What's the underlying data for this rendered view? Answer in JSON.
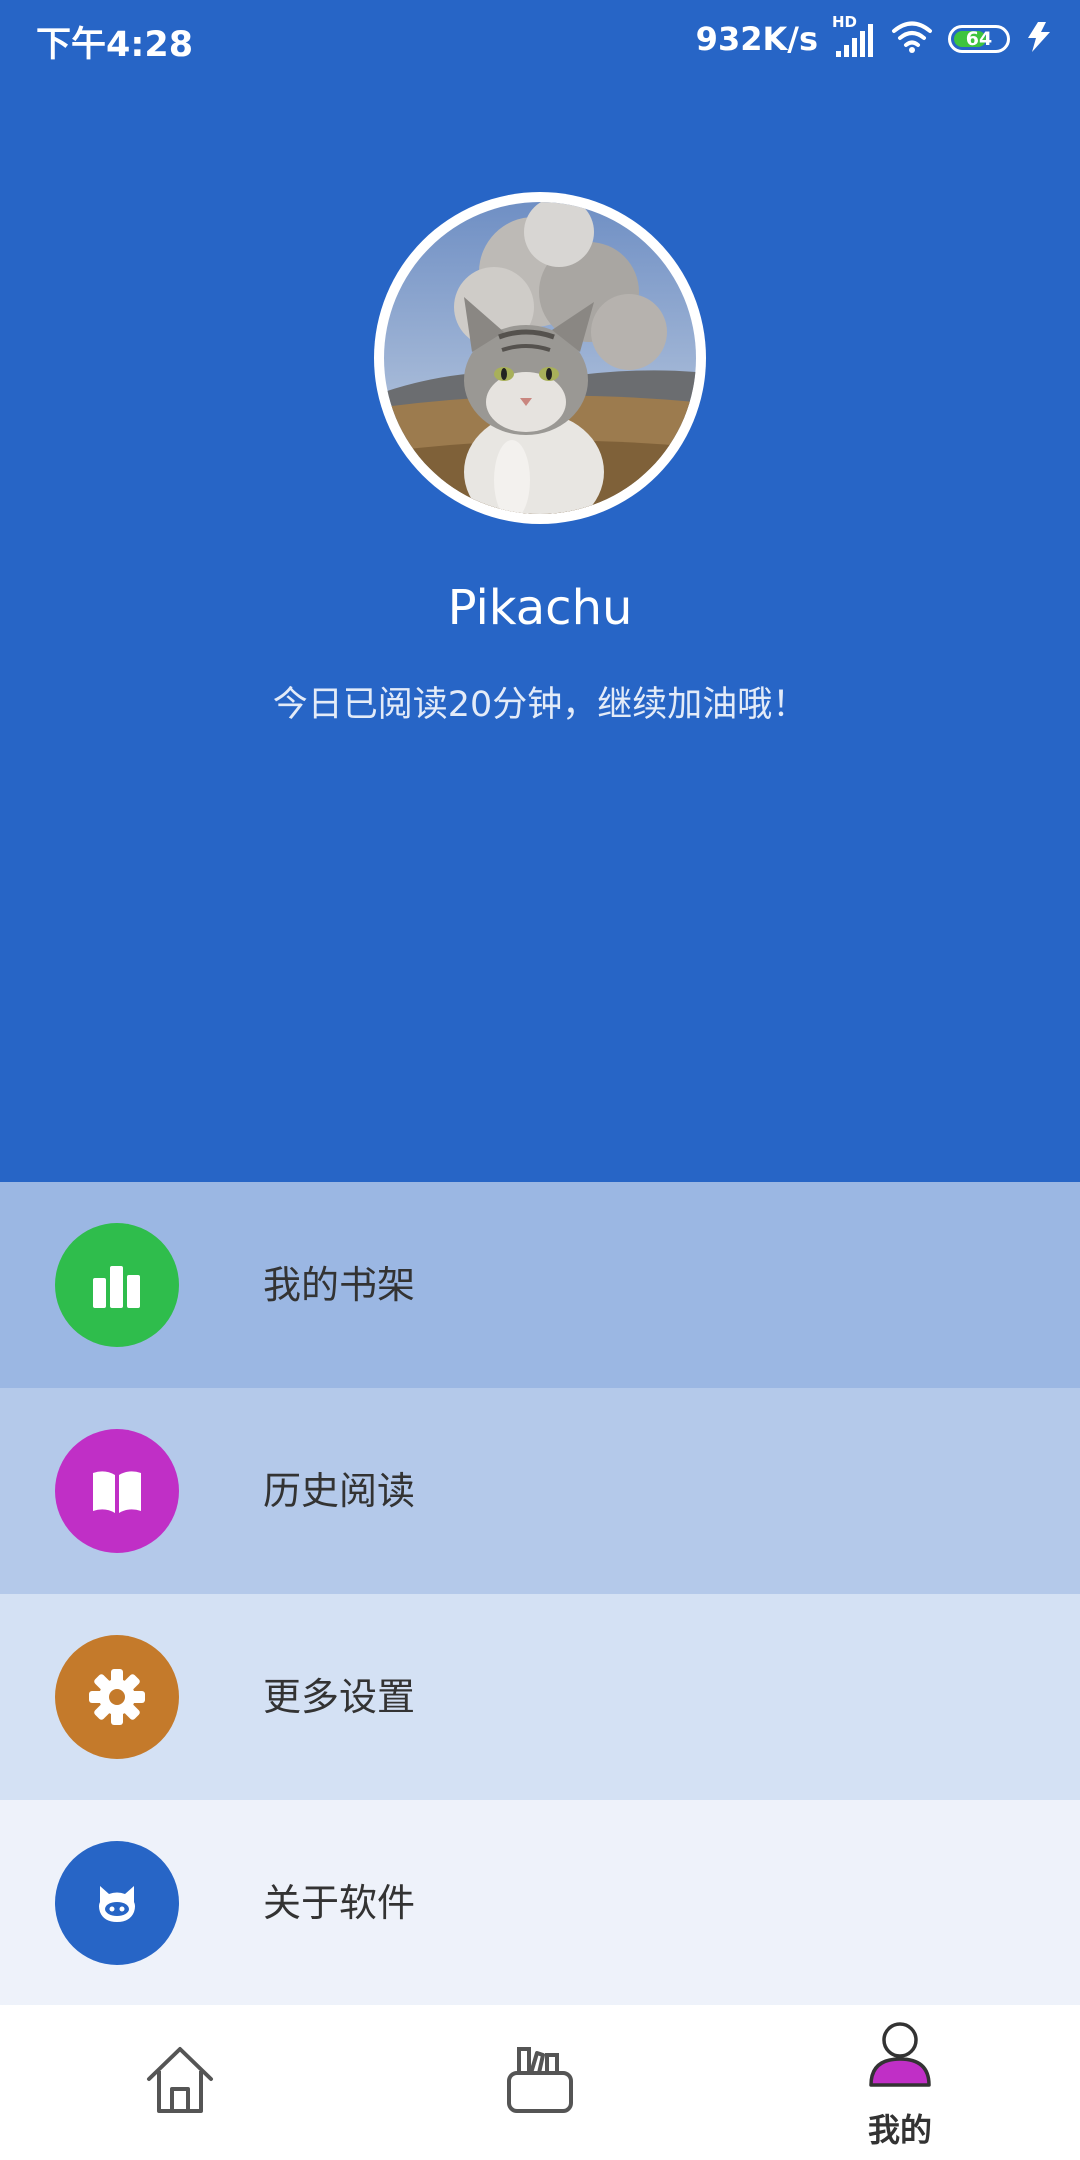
{
  "status_bar": {
    "time": "下午4:28",
    "net_speed": "932K/s",
    "network_tag": "HD",
    "battery": "64",
    "battery_level": 0.64
  },
  "profile": {
    "username": "Pikachu",
    "reading_message": "今日已阅读20分钟，继续加油哦！"
  },
  "menu": [
    {
      "label": "我的书架",
      "icon": "bar-chart-icon",
      "icon_color": "#2fbd4c",
      "bg": "#9bb7e3"
    },
    {
      "label": "历史阅读",
      "icon": "open-book-icon",
      "icon_color": "#c02fc6",
      "bg": "#b4c9ea"
    },
    {
      "label": "更多设置",
      "icon": "gear-icon",
      "icon_color": "#c47a2b",
      "bg": "#d4e1f4"
    },
    {
      "label": "关于软件",
      "icon": "github-cat-icon",
      "icon_color": "#2765c6",
      "bg": "#eef2fa"
    }
  ],
  "bottom_nav": {
    "items": [
      {
        "name": "home",
        "icon": "home-icon",
        "label": ""
      },
      {
        "name": "bookshelf",
        "icon": "bookshelf-icon",
        "label": ""
      },
      {
        "name": "mine",
        "icon": "profile-icon",
        "label": "我的",
        "active": true
      }
    ]
  },
  "colors": {
    "primary": "#2765c6",
    "active_accent": "#c02fc6"
  }
}
